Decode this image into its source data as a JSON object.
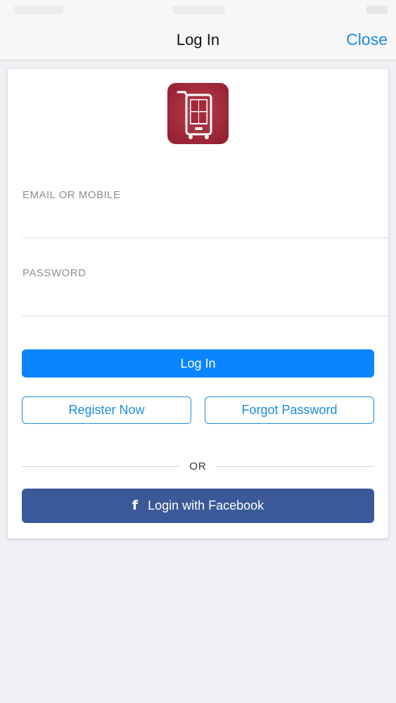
{
  "nav": {
    "title": "Log In",
    "close_label": "Close"
  },
  "app_logo": {
    "icon": "shopping-cart-phone-icon",
    "color": "#a32a3b"
  },
  "form": {
    "email_label": "EMAIL OR MOBILE",
    "email_value": "",
    "password_label": "PASSWORD",
    "password_value": "",
    "login_label": "Log In",
    "register_label": "Register Now",
    "forgot_label": "Forgot Password",
    "or_text": "OR",
    "facebook_icon": "facebook-icon",
    "facebook_glyph": "f",
    "facebook_label": "Login with Facebook"
  },
  "colors": {
    "accent": "#0a84ff",
    "link": "#1a8ce6",
    "facebook": "#3b5998",
    "background": "#efeff4"
  }
}
